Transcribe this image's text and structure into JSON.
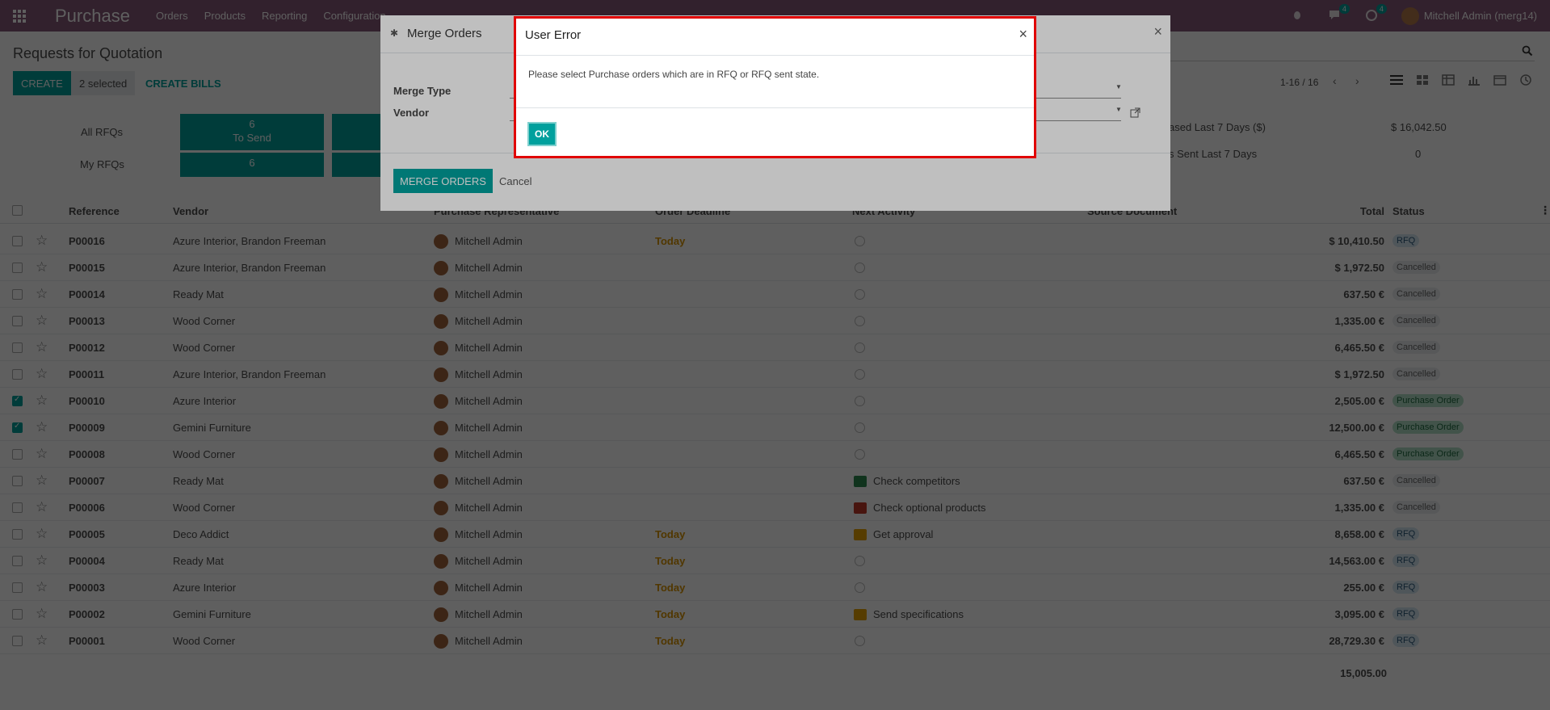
{
  "navbar": {
    "app_title": "Purchase",
    "menu": [
      "Orders",
      "Products",
      "Reporting",
      "Configuration"
    ],
    "messages_count": "4",
    "activities_count": "4",
    "user_name": "Mitchell Admin (merg14)"
  },
  "control_panel": {
    "title": "Requests for Quotation",
    "create_label": "CREATE",
    "selected_label": "2 selected",
    "create_bills_label": "CREATE BILLS",
    "pager": "1-16 / 16"
  },
  "dashboard": {
    "all_rfqs_label": "All RFQs",
    "my_rfqs_label": "My RFQs",
    "tile_to_send_count": "6",
    "tile_to_send_label": "To Send",
    "tile_my_count": "6",
    "purchased_label": "ased Last 7 Days ($)",
    "purchased_value": "$ 16,042.50",
    "sent_label": "s Sent Last 7 Days",
    "sent_value": "0"
  },
  "list": {
    "columns": [
      "Reference",
      "Vendor",
      "Purchase Representative",
      "Order Deadline",
      "Next Activity",
      "Source Document",
      "Total",
      "Status"
    ],
    "rows": [
      {
        "ref": "P00016",
        "vendor": "Azure Interior, Brandon Freeman",
        "rep": "Mitchell Admin",
        "deadline": "Today",
        "activity": "",
        "total": "$ 10,410.50",
        "status": "RFQ",
        "checked": false
      },
      {
        "ref": "P00015",
        "vendor": "Azure Interior, Brandon Freeman",
        "rep": "Mitchell Admin",
        "deadline": "",
        "activity": "",
        "total": "$ 1,972.50",
        "status": "Cancelled",
        "checked": false
      },
      {
        "ref": "P00014",
        "vendor": "Ready Mat",
        "rep": "Mitchell Admin",
        "deadline": "",
        "activity": "",
        "total": "637.50 €",
        "status": "Cancelled",
        "checked": false
      },
      {
        "ref": "P00013",
        "vendor": "Wood Corner",
        "rep": "Mitchell Admin",
        "deadline": "",
        "activity": "",
        "total": "1,335.00 €",
        "status": "Cancelled",
        "checked": false
      },
      {
        "ref": "P00012",
        "vendor": "Wood Corner",
        "rep": "Mitchell Admin",
        "deadline": "",
        "activity": "",
        "total": "6,465.50 €",
        "status": "Cancelled",
        "checked": false
      },
      {
        "ref": "P00011",
        "vendor": "Azure Interior, Brandon Freeman",
        "rep": "Mitchell Admin",
        "deadline": "",
        "activity": "",
        "total": "$ 1,972.50",
        "status": "Cancelled",
        "checked": false
      },
      {
        "ref": "P00010",
        "vendor": "Azure Interior",
        "rep": "Mitchell Admin",
        "deadline": "",
        "activity": "",
        "total": "2,505.00 €",
        "status": "Purchase Order",
        "checked": true
      },
      {
        "ref": "P00009",
        "vendor": "Gemini Furniture",
        "rep": "Mitchell Admin",
        "deadline": "",
        "activity": "",
        "total": "12,500.00 €",
        "status": "Purchase Order",
        "checked": true
      },
      {
        "ref": "P00008",
        "vendor": "Wood Corner",
        "rep": "Mitchell Admin",
        "deadline": "",
        "activity": "",
        "total": "6,465.50 €",
        "status": "Purchase Order",
        "checked": false
      },
      {
        "ref": "P00007",
        "vendor": "Ready Mat",
        "rep": "Mitchell Admin",
        "deadline": "",
        "activity": "Check competitors",
        "activity_color": "#2d8a4e",
        "total": "637.50 €",
        "status": "Cancelled",
        "checked": false
      },
      {
        "ref": "P00006",
        "vendor": "Wood Corner",
        "rep": "Mitchell Admin",
        "deadline": "",
        "activity": "Check optional products",
        "activity_color": "#c0392b",
        "total": "1,335.00 €",
        "status": "Cancelled",
        "checked": false
      },
      {
        "ref": "P00005",
        "vendor": "Deco Addict",
        "rep": "Mitchell Admin",
        "deadline": "Today",
        "activity": "Get approval",
        "activity_color": "#e6a100",
        "total": "8,658.00 €",
        "status": "RFQ",
        "checked": false
      },
      {
        "ref": "P00004",
        "vendor": "Ready Mat",
        "rep": "Mitchell Admin",
        "deadline": "Today",
        "activity": "",
        "total": "14,563.00 €",
        "status": "RFQ",
        "checked": false
      },
      {
        "ref": "P00003",
        "vendor": "Azure Interior",
        "rep": "Mitchell Admin",
        "deadline": "Today",
        "activity": "",
        "total": "255.00 €",
        "status": "RFQ",
        "checked": false
      },
      {
        "ref": "P00002",
        "vendor": "Gemini Furniture",
        "rep": "Mitchell Admin",
        "deadline": "Today",
        "activity": "Send specifications",
        "activity_color": "#e6a100",
        "total": "3,095.00 €",
        "status": "RFQ",
        "checked": false
      },
      {
        "ref": "P00001",
        "vendor": "Wood Corner",
        "rep": "Mitchell Admin",
        "deadline": "Today",
        "activity": "",
        "total": "28,729.30 €",
        "status": "RFQ",
        "checked": false
      }
    ],
    "grand_total": "15,005.00"
  },
  "merge_dialog": {
    "title": "Merge Orders",
    "merge_type_label": "Merge Type",
    "vendor_label": "Vendor",
    "merge_button": "MERGE ORDERS",
    "cancel_button": "Cancel"
  },
  "error_dialog": {
    "title": "User Error",
    "message": "Please select Purchase orders which are in RFQ or RFQ sent state.",
    "ok_button": "OK"
  },
  "colors": {
    "brand": "#875a7b",
    "accent": "#00a09d",
    "error_border": "#e00000"
  }
}
